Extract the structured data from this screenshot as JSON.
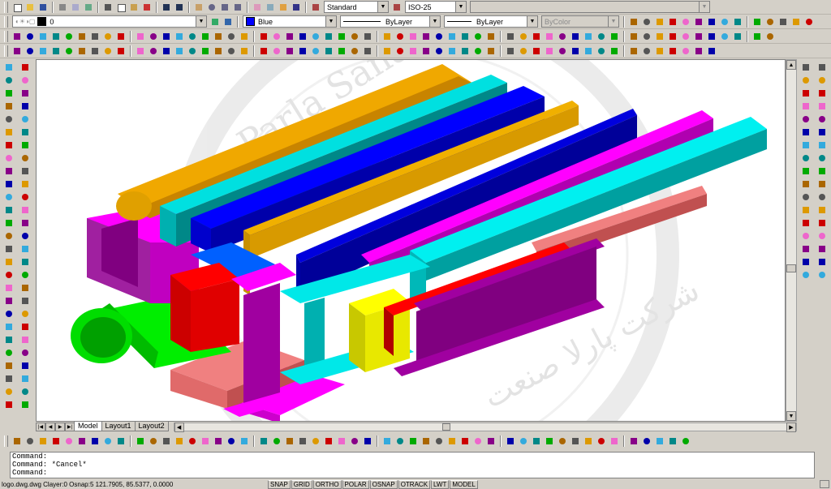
{
  "toolbars": {
    "text_style": "Standard",
    "dim_style": "ISO-25",
    "layer": "0",
    "color": "Blue",
    "color_hex": "#0000ff",
    "linetype": "ByLayer",
    "lineweight": "ByLayer",
    "plotstyle": "ByColor"
  },
  "layout_tabs": [
    "Model",
    "Layout1",
    "Layout2"
  ],
  "command_lines": [
    "Command:",
    "Command: *Cancel*",
    "Command:"
  ],
  "status": {
    "info": "logo.dwg.dwg  Clayer:0  Osnap:5  121.7905, 85.5377, 0.0000",
    "toggles": [
      "SNAP",
      "GRID",
      "ORTHO",
      "POLAR",
      "OSNAP",
      "OTRACK",
      "LWT",
      "MODEL"
    ]
  },
  "watermark": {
    "latin": "Parla Sanat",
    "arabic": "شرکت پارلا صنعت"
  }
}
